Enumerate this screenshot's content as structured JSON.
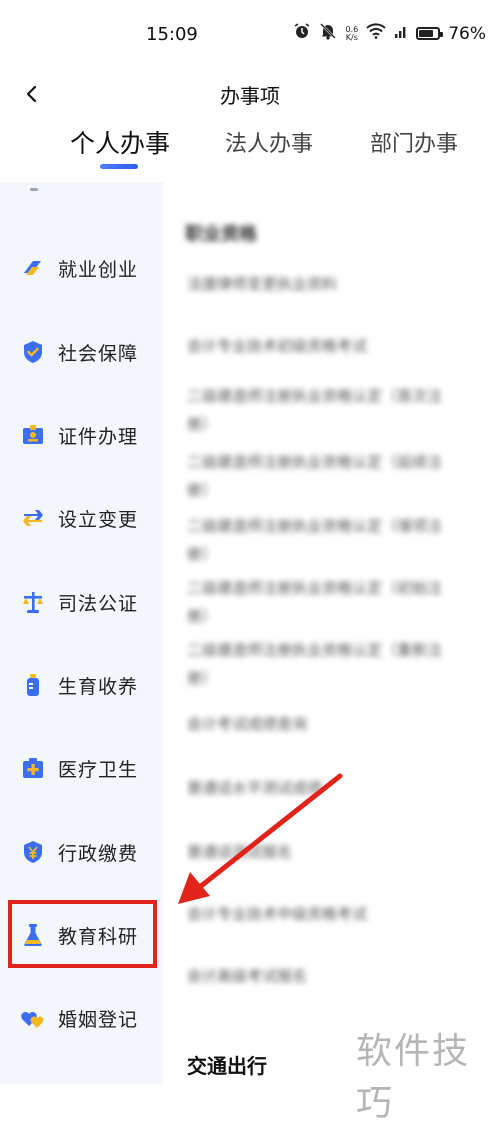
{
  "status_bar": {
    "time": "15:09",
    "net_speed_value": "0.6",
    "net_speed_unit": "K/s",
    "battery_level": 0.76,
    "battery_text": "76%"
  },
  "nav": {
    "back_icon": "chevron-left-icon",
    "title": "办事项"
  },
  "tabs": [
    {
      "label": "个人办事",
      "active": true
    },
    {
      "label": "法人办事",
      "active": false
    },
    {
      "label": "部门办事",
      "active": false
    }
  ],
  "sidebar": {
    "items": [
      {
        "label": "就业创业",
        "icon": "briefcase-icon"
      },
      {
        "label": "社会保障",
        "icon": "shield-check-icon"
      },
      {
        "label": "证件办理",
        "icon": "id-card-icon"
      },
      {
        "label": "设立变更",
        "icon": "swap-arrows-icon"
      },
      {
        "label": "司法公证",
        "icon": "scales-icon"
      },
      {
        "label": "生育收养",
        "icon": "baby-bottle-icon"
      },
      {
        "label": "医疗卫生",
        "icon": "medical-kit-icon"
      },
      {
        "label": "行政缴费",
        "icon": "yuan-coin-icon"
      },
      {
        "label": "教育科研",
        "icon": "flask-icon"
      },
      {
        "label": "婚姻登记",
        "icon": "hearts-icon"
      }
    ]
  },
  "content": {
    "category_1": "职业资格",
    "items": [
      "法援律师变更执业资料",
      "会计专业技术初级资格考试",
      "二级建造师注册执业资格认定（首次注册）",
      "二级建造师注册执业资格认定（延续注册）",
      "二级建造师注册执业资格认定（增项注册）",
      "二级建造师注册执业资格认定（初始注册）",
      "二级建造师注册执业资格认定（重新注册）",
      "会计考试成绩查询",
      "普通话水平测试成绩",
      "普通话测试报名",
      "会计专业技术中级资格考试",
      "会计高级考试报名"
    ],
    "category_2": "交通出行"
  },
  "annotation": {
    "arrow_color": "#e2231a",
    "highlight_color": "#e2231a"
  },
  "watermark": "软件技巧"
}
